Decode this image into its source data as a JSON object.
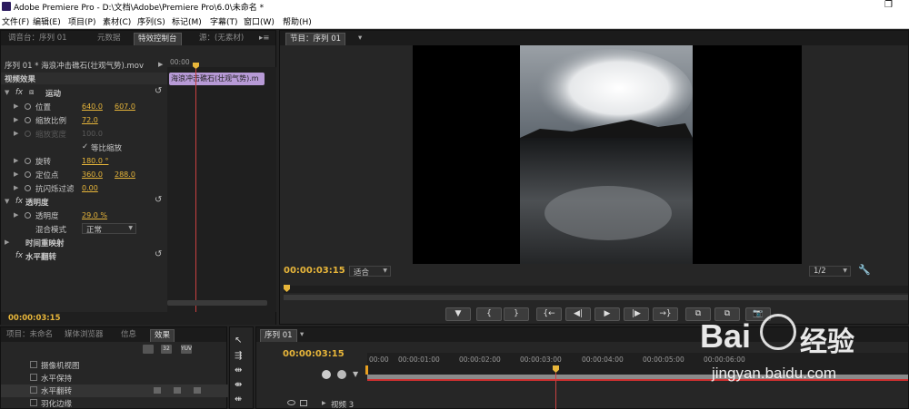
{
  "app": {
    "title": "Adobe Premiere Pro - D:\\文档\\Adobe\\Premiere Pro\\6.0\\未命名 *",
    "restore_glyph": "❐"
  },
  "menu": [
    "文件(F)",
    "编辑(E)",
    "项目(P)",
    "素材(C)",
    "序列(S)",
    "标记(M)",
    "字幕(T)",
    "窗口(W)",
    "帮助(H)"
  ],
  "effect_controls": {
    "tabs": [
      "调音台：序列 01",
      "元数据",
      "特效控制台",
      "源：(无素材)"
    ],
    "clip_header": "序列 01 * 海浪冲击礁石(壮观气势).mov",
    "timecode_start": "00:00",
    "clip_bar_label": "海浪冲击礁石(壮观气势).m",
    "section": "视频效果",
    "motion": "运动",
    "position_label": "位置",
    "position_x": "640.0",
    "position_y": "607.0",
    "scale_label": "缩放比例",
    "scale_value": "72.0",
    "scale_width_label": "缩放宽度",
    "scale_width_value": "100.0",
    "uniform_label": "等比缩放",
    "rotation_label": "旋转",
    "rotation_value": "180.0 °",
    "anchor_label": "定位点",
    "anchor_x": "360.0",
    "anchor_y": "288.0",
    "antiflicker_label": "抗闪烁过滤",
    "antiflicker_value": "0.00",
    "opacity_section": "透明度",
    "opacity_label": "透明度",
    "opacity_value": "29.0 %",
    "blend_label": "混合模式",
    "blend_value": "正常",
    "time_remap": "时间重映射",
    "horizontal_flip": "水平翻转",
    "bottom_timecode": "00:00:03:15"
  },
  "program_monitor": {
    "tab": "节目：序列 01",
    "timecode": "00:00:03:15",
    "fit": "适合",
    "resolution": "1/2",
    "controls": [
      "▼",
      "{",
      "}",
      "{←",
      "◀|",
      "▶",
      "|▶",
      "→}",
      "⧉",
      "⧉",
      "📷"
    ]
  },
  "project_panel": {
    "tabs": [
      "项目：未命名",
      "媒体浏览器",
      "信息",
      "效果"
    ],
    "items": [
      "摄像机视图",
      "水平保持",
      "水平翻转",
      "羽化边缘"
    ]
  },
  "timeline": {
    "tab": "序列 01",
    "timecode": "00:00:03:15",
    "ticks": [
      "00:00",
      "00:00:01:00",
      "00:00:02:00",
      "00:00:03:00",
      "00:00:04:00",
      "00:00:05:00",
      "00:00:06:00"
    ],
    "track": "视频 3"
  },
  "watermark": {
    "brand": "Bai",
    "brand2": "经验",
    "url": "jingyan.baidu.com"
  }
}
